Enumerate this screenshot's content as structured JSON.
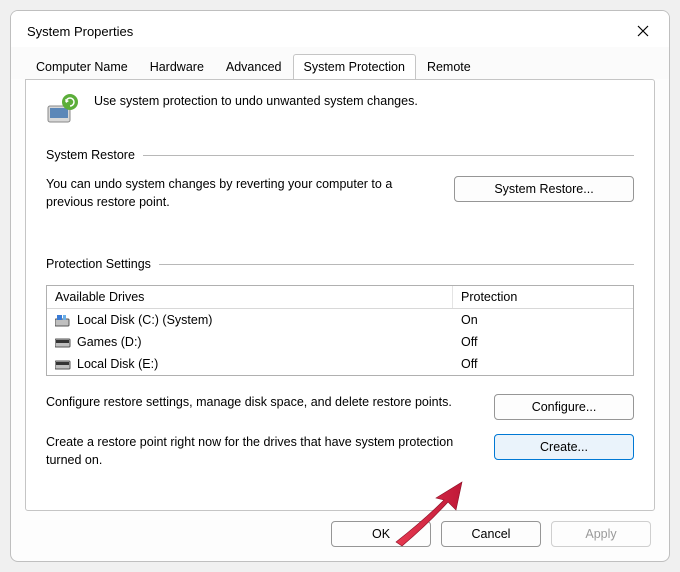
{
  "window": {
    "title": "System Properties"
  },
  "tabs": {
    "computer_name": "Computer Name",
    "hardware": "Hardware",
    "advanced": "Advanced",
    "system_protection": "System Protection",
    "remote": "Remote"
  },
  "intro": {
    "text": "Use system protection to undo unwanted system changes."
  },
  "restore_section": {
    "title": "System Restore",
    "desc": "You can undo system changes by reverting your computer to a previous restore point.",
    "button": "System Restore..."
  },
  "protection_section": {
    "title": "Protection Settings",
    "col_drives": "Available Drives",
    "col_protection": "Protection",
    "drives": [
      {
        "name": "Local Disk (C:) (System)",
        "status": "On",
        "icon": "system"
      },
      {
        "name": "Games (D:)",
        "status": "Off",
        "icon": "disk"
      },
      {
        "name": "Local Disk (E:)",
        "status": "Off",
        "icon": "disk"
      }
    ],
    "configure_desc": "Configure restore settings, manage disk space, and delete restore points.",
    "configure_button": "Configure...",
    "create_desc": "Create a restore point right now for the drives that have system protection turned on.",
    "create_button": "Create..."
  },
  "buttons": {
    "ok": "OK",
    "cancel": "Cancel",
    "apply": "Apply"
  }
}
